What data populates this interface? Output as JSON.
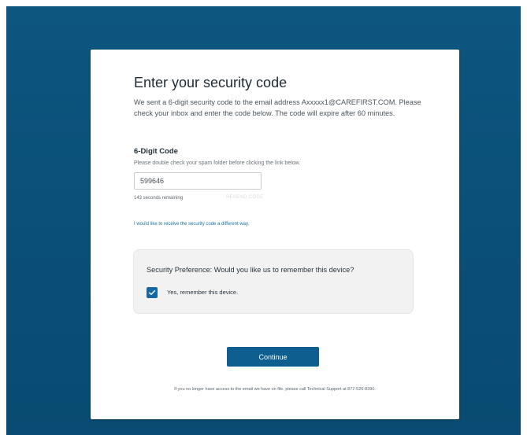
{
  "page": {
    "title": "Enter your security code",
    "intro": "We sent a 6-digit security code to the email address Axxxxx1@CAREFIRST.COM. Please check your inbox and enter the code below. The code will expire after 60 minutes."
  },
  "code": {
    "label": "6-Digit Code",
    "hint": "Please double check your spam folder before clicking the link below.",
    "value": "599646",
    "timer": "143 seconds remaining",
    "resend_label": "RESEND CODE"
  },
  "alt_link": "I would like to receive the security code a different way.",
  "preference": {
    "question": "Security Preference: Would you like us to remember this device?",
    "checkbox_label": "Yes, remember this device.",
    "checked": true
  },
  "continue_label": "Continue",
  "footnote": "If you no longer have access to the email we have on file, please call Technical Support at 877-526-8390.",
  "colors": {
    "background": "#0b5079",
    "primary": "#0e5f90",
    "link": "#1d6fa8",
    "checkbox": "#1667a5"
  },
  "icons": {
    "checkbox": "check-icon"
  }
}
